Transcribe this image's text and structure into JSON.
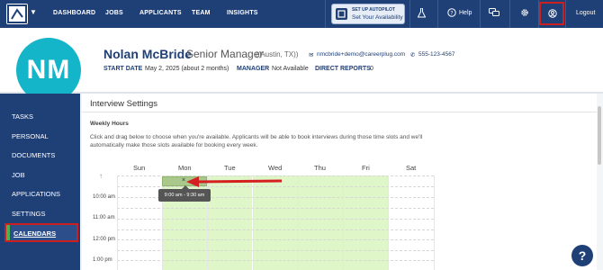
{
  "topnav": {
    "items": [
      "DASHBOARD",
      "JOBS",
      "APPLICANTS",
      "TEAM",
      "INSIGHTS"
    ],
    "autopilot_line1": "SET UP AUTOPILOT",
    "autopilot_line2": "Set Your Availability",
    "help_label": "Help",
    "logout_label": "Logout",
    "bg_color": "#1f3f77"
  },
  "profile": {
    "initials": "NM",
    "name": "Nolan McBride",
    "role": "Senior Manager",
    "location": "((Austin, TX))",
    "email": "nmcbride+demo@careerplug.com",
    "phone": "555-123-4567",
    "start_date_label": "START DATE",
    "start_date_value": "May 2, 2025 (about 2 months)",
    "manager_label": "MANAGER",
    "manager_value": "Not Available",
    "direct_reports_label": "DIRECT REPORTS",
    "direct_reports_value": "0",
    "avatar_color": "#15b5c9"
  },
  "sidebar": {
    "items": [
      "TASKS",
      "PERSONAL",
      "DOCUMENTS",
      "JOB",
      "APPLICATIONS",
      "SETTINGS",
      "CALENDARS"
    ],
    "active": "CALENDARS"
  },
  "interview": {
    "title": "Interview Settings",
    "weekly_hours": "Weekly Hours",
    "description": "Click and drag below to choose when you're available. Applicants will be able to book interviews during those time slots and we'll automatically make those slots available for booking every week.",
    "days": [
      "Sun",
      "Mon",
      "Tue",
      "Wed",
      "Thu",
      "Fri",
      "Sat"
    ],
    "times": [
      "10:00 am",
      "11:00 am",
      "12:00 pm",
      "1:00 pm"
    ],
    "selected_slot_tooltip": "9:00 am - 9:30 am",
    "slot_close": "×",
    "available_color": "#dff6c8"
  },
  "help_fab": "?"
}
